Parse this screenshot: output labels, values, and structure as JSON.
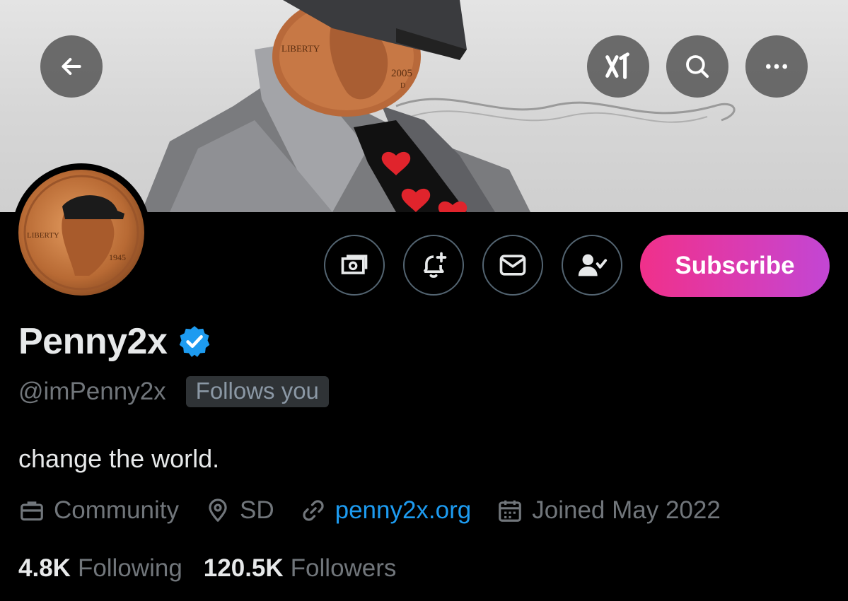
{
  "header": {
    "back_icon": "arrow-left-icon",
    "grok_icon": "grok-icon",
    "search_icon": "search-icon",
    "more_icon": "more-horizontal-icon",
    "banner_coin_text": {
      "liberty": "LIBERTY",
      "year": "2005",
      "mint": "D"
    }
  },
  "avatar": {
    "coin_text": {
      "liberty": "LIBERTY",
      "year": "1945"
    }
  },
  "actions": {
    "tip_icon": "money-icon",
    "notify_icon": "bell-plus-icon",
    "message_icon": "envelope-icon",
    "following_icon": "user-check-icon",
    "subscribe_label": "Subscribe"
  },
  "profile": {
    "display_name": "Penny2x",
    "verified": true,
    "handle": "@imPenny2x",
    "follows_you": "Follows you",
    "bio": "change the world.",
    "category": "Community",
    "location": "SD",
    "website": "penny2x.org",
    "joined": "Joined May 2022"
  },
  "stats": {
    "following_count": "4.8K",
    "following_label": "Following",
    "followers_count": "120.5K",
    "followers_label": "Followers"
  },
  "colors": {
    "background": "#000000",
    "text_primary": "#e7e9ea",
    "text_secondary": "#71767b",
    "link": "#1d9bf0",
    "verified": "#1d9bf0",
    "subscribe_gradient_start": "#f0308a",
    "subscribe_gradient_end": "#c246d4"
  }
}
